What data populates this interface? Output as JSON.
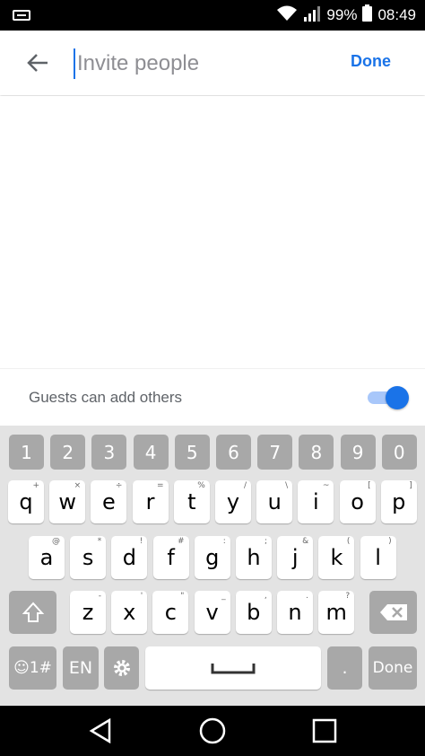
{
  "status_bar": {
    "battery": "99%",
    "time": "08:49"
  },
  "app_bar": {
    "placeholder": "Invite people",
    "done": "Done"
  },
  "guests": {
    "label": "Guests can add others",
    "enabled": true
  },
  "keyboard": {
    "numbers": [
      "1",
      "2",
      "3",
      "4",
      "5",
      "6",
      "7",
      "8",
      "9",
      "0"
    ],
    "row1": [
      {
        "k": "q",
        "h": "+"
      },
      {
        "k": "w",
        "h": "×"
      },
      {
        "k": "e",
        "h": "÷"
      },
      {
        "k": "r",
        "h": "="
      },
      {
        "k": "t",
        "h": "%"
      },
      {
        "k": "y",
        "h": "/"
      },
      {
        "k": "u",
        "h": "\\"
      },
      {
        "k": "i",
        "h": "~"
      },
      {
        "k": "o",
        "h": "["
      },
      {
        "k": "p",
        "h": "]"
      }
    ],
    "row2": [
      {
        "k": "a",
        "h": "@"
      },
      {
        "k": "s",
        "h": "*"
      },
      {
        "k": "d",
        "h": "!"
      },
      {
        "k": "f",
        "h": "#"
      },
      {
        "k": "g",
        "h": ":"
      },
      {
        "k": "h",
        "h": ";"
      },
      {
        "k": "j",
        "h": "&"
      },
      {
        "k": "k",
        "h": "("
      },
      {
        "k": "l",
        "h": ")"
      }
    ],
    "row3": [
      {
        "k": "z",
        "h": "-"
      },
      {
        "k": "x",
        "h": "'"
      },
      {
        "k": "c",
        "h": "\""
      },
      {
        "k": "v",
        "h": "_"
      },
      {
        "k": "b",
        "h": ","
      },
      {
        "k": "n",
        "h": "."
      },
      {
        "k": "m",
        "h": "?"
      }
    ],
    "emoji_key": "☺1#",
    "lang_key": "EN",
    "period_key": ".",
    "done_key": "Done"
  },
  "colors": {
    "accent": "#1a73e8",
    "toggle_track": "#a8c7fa"
  }
}
